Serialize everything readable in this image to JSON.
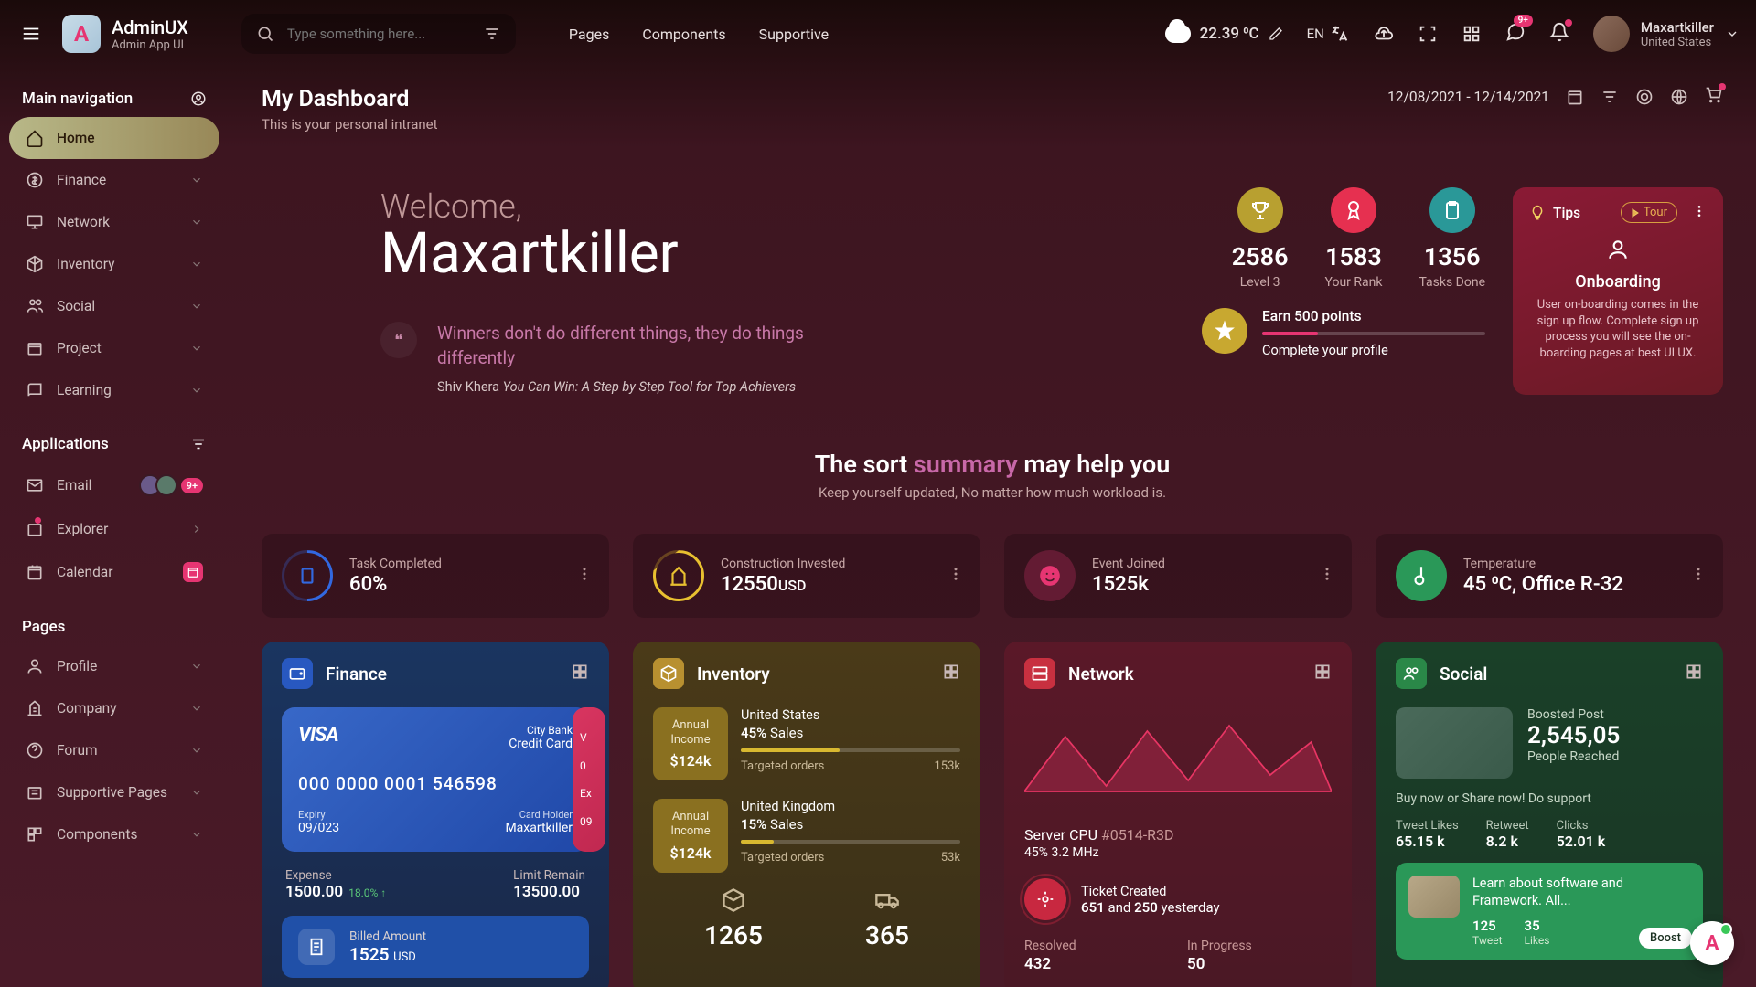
{
  "header": {
    "logo_title": "AdminUX",
    "logo_sub": "Admin App UI",
    "search_placeholder": "Type something here...",
    "nav": [
      "Pages",
      "Components",
      "Supportive"
    ],
    "weather_temp": "22.39 ⁰C",
    "lang": "EN",
    "badge_msg": "9+",
    "user_name": "Maxartkiller",
    "user_loc": "United States"
  },
  "sidebar": {
    "heading_main": "Main navigation",
    "items_main": [
      "Home",
      "Finance",
      "Network",
      "Inventory",
      "Social",
      "Project",
      "Learning"
    ],
    "heading_apps": "Applications",
    "items_apps": [
      "Email",
      "Explorer",
      "Calendar"
    ],
    "apps_badge": "9+",
    "heading_pages": "Pages",
    "items_pages": [
      "Profile",
      "Company",
      "Forum",
      "Supportive Pages",
      "Components"
    ]
  },
  "page": {
    "title": "My Dashboard",
    "sub": "This is your personal intranet",
    "date_range": "12/08/2021 - 12/14/2021"
  },
  "welcome": {
    "label": "Welcome,",
    "name": "Maxartkiller",
    "quote": "Winners don't do different things, they do things differently",
    "quote_author": "Shiv Khera",
    "quote_book": "You Can Win: A Step by Step Tool for Top Achievers"
  },
  "stats": {
    "level_num": "2586",
    "level_lbl": "Level 3",
    "rank_num": "1583",
    "rank_lbl": "Your Rank",
    "tasks_num": "1356",
    "tasks_lbl": "Tasks Done",
    "earn_title": "Earn 500 points",
    "earn_sub": "Complete your profile"
  },
  "tips": {
    "title": "Tips",
    "tour": "Tour",
    "heading": "Onboarding",
    "desc": "User on-boarding comes in the sign up flow. Complete sign up process you will see the on-boarding pages at best UI UX."
  },
  "summary": {
    "title_pre": "The sort ",
    "title_accent": "summary",
    "title_post": " may help you",
    "sub": "Keep yourself updated, No matter how much workload is."
  },
  "mini": {
    "task_lbl": "Task Completed",
    "task_val": "60%",
    "constr_lbl": "Construction Invested",
    "constr_val": "12550",
    "constr_unit": "USD",
    "event_lbl": "Event Joined",
    "event_val": "1525k",
    "temp_lbl": "Temperature",
    "temp_val": "45 ⁰C, Office R-32"
  },
  "finance": {
    "title": "Finance",
    "visa": "VISA",
    "bank": "City Bank",
    "type": "Credit Card",
    "number": "000 0000 0001 546598",
    "exp_lbl": "Expiry",
    "exp_val": "09/023",
    "holder_lbl": "Card Holder",
    "holder_val": "Maxartkiller",
    "next_visa": "V",
    "next_num": "0",
    "next_exp": "Ex",
    "next_09": "09",
    "expense_lbl": "Expense",
    "expense_val": "1500.00",
    "expense_pct": "18.0% ↑",
    "limit_lbl": "Limit Remain",
    "limit_val": "13500.00",
    "billed_lbl": "Billed Amount",
    "billed_val": "1525",
    "billed_unit": "USD"
  },
  "inventory": {
    "title": "Inventory",
    "box1_lbl": "Annual Income",
    "box1_val": "$124k",
    "c1_name": "United States",
    "c1_sales": "45%",
    "c1_sales_lbl": "Sales",
    "c1_target_lbl": "Targeted orders",
    "c1_target_val": "153k",
    "box2_lbl": "Annual Income",
    "box2_val": "$124k",
    "c2_name": "United Kingdom",
    "c2_sales": "15%",
    "c2_sales_lbl": "Sales",
    "c2_target_lbl": "Targeted orders",
    "c2_target_val": "53k",
    "b1_val": "1265",
    "b2_val": "365"
  },
  "network": {
    "title": "Network",
    "cpu_lbl": "Server CPU ",
    "cpu_id": "#0514-R3D",
    "cpu_sub": "45% 3.2 MHz",
    "ticket_lbl": "Ticket Created",
    "ticket_b": "651",
    "ticket_mid": " and ",
    "ticket_b2": "250",
    "ticket_end": " yesterday",
    "res_lbl": "Resolved",
    "res_val": "432",
    "prog_lbl": "In Progress",
    "prog_val": "50"
  },
  "social": {
    "title": "Social",
    "boost_lbl": "Boosted Post",
    "boost_val": "2,545,05",
    "boost_sub": "People Reached",
    "msg": "Buy now or Share now! Do support",
    "s1_lbl": "Tweet Likes",
    "s1_val": "65.15 k",
    "s2_lbl": "Retweet",
    "s2_val": "8.2 k",
    "s3_lbl": "Clicks",
    "s3_val": "52.01 k",
    "learn_text": "Learn about software and Framework. All...",
    "l1_v": "125",
    "l1_l": "Tweet",
    "l2_v": "35",
    "l2_l": "Likes",
    "boost_btn": "Boost"
  }
}
